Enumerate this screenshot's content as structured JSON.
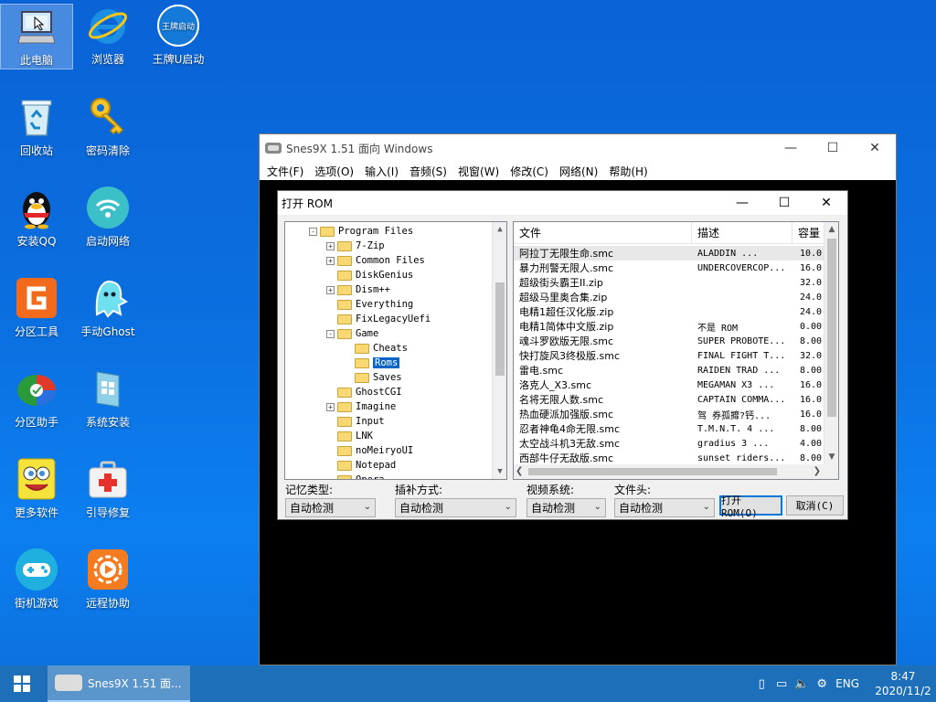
{
  "desktop": {
    "icons": [
      {
        "label": "此电脑",
        "icon": "computer-icon"
      },
      {
        "label": "浏览器",
        "icon": "ie-browser-icon"
      },
      {
        "label": "王牌U启动",
        "icon": "wangpai-icon",
        "badge": "王牌启动"
      },
      {
        "label": "回收站",
        "icon": "recycle-bin-icon"
      },
      {
        "label": "密码清除",
        "icon": "key-icon"
      },
      {
        "label": "安装QQ",
        "icon": "qq-penguin-icon"
      },
      {
        "label": "启动网络",
        "icon": "wifi-icon"
      },
      {
        "label": "分区工具",
        "icon": "diskgenius-icon"
      },
      {
        "label": "手动Ghost",
        "icon": "ghost-icon"
      },
      {
        "label": "分区助手",
        "icon": "partition-assistant-icon"
      },
      {
        "label": "系统安装",
        "icon": "system-install-icon"
      },
      {
        "label": "更多软件",
        "icon": "spongebob-icon"
      },
      {
        "label": "引导修复",
        "icon": "first-aid-kit-icon"
      },
      {
        "label": "街机游戏",
        "icon": "gamepad-icon"
      },
      {
        "label": "远程协助",
        "icon": "remote-assist-icon"
      }
    ]
  },
  "snes_window": {
    "title": "Snes9X 1.51 面向 Windows",
    "menu": [
      "文件(F)",
      "选项(O)",
      "输入(I)",
      "音频(S)",
      "视窗(W)",
      "修改(C)",
      "网络(N)",
      "帮助(H)"
    ]
  },
  "dialog": {
    "title": "打开 ROM",
    "tree": [
      {
        "label": "Program Files",
        "toggle": "-",
        "depth": 0
      },
      {
        "label": "7-Zip",
        "toggle": "+",
        "depth": 1
      },
      {
        "label": "Common Files",
        "toggle": "+",
        "depth": 1
      },
      {
        "label": "DiskGenius",
        "toggle": "",
        "depth": 1
      },
      {
        "label": "Dism++",
        "toggle": "+",
        "depth": 1
      },
      {
        "label": "Everything",
        "toggle": "",
        "depth": 1
      },
      {
        "label": "FixLegacyUefi",
        "toggle": "",
        "depth": 1
      },
      {
        "label": "Game",
        "toggle": "-",
        "depth": 1
      },
      {
        "label": "Cheats",
        "toggle": "",
        "depth": 2
      },
      {
        "label": "Roms",
        "toggle": "",
        "depth": 2,
        "selected": true
      },
      {
        "label": "Saves",
        "toggle": "",
        "depth": 2
      },
      {
        "label": "GhostCGI",
        "toggle": "",
        "depth": 1
      },
      {
        "label": "Imagine",
        "toggle": "+",
        "depth": 1
      },
      {
        "label": "Input",
        "toggle": "",
        "depth": 1
      },
      {
        "label": "LNK",
        "toggle": "",
        "depth": 1
      },
      {
        "label": "noMeiryoUI",
        "toggle": "",
        "depth": 1
      },
      {
        "label": "Notepad",
        "toggle": "",
        "depth": 1
      },
      {
        "label": "Opera",
        "toggle": "",
        "depth": 1
      }
    ],
    "columns": [
      "文件",
      "描述",
      "容量"
    ],
    "files": [
      {
        "name": "阿拉丁无限生命.smc",
        "desc": "ALADDIN     ...",
        "size": "10.0"
      },
      {
        "name": "暴力刑警无限人.smc",
        "desc": "UNDERCOVERCOP...",
        "size": "16.0"
      },
      {
        "name": "超级街头霸王II.zip",
        "desc": "",
        "size": "32.0"
      },
      {
        "name": "超级马里奥合集.zip",
        "desc": "",
        "size": "24.0"
      },
      {
        "name": "电精1超任汉化版.zip",
        "desc": "",
        "size": "24.0"
      },
      {
        "name": "电精1简体中文版.zip",
        "desc": "不是 ROM",
        "size": "0.00"
      },
      {
        "name": "魂斗罗欧版无限.smc",
        "desc": "SUPER PROBOTE...",
        "size": "8.00"
      },
      {
        "name": "快打旋风3终极版.smc",
        "desc": "FINAL FIGHT T...",
        "size": "32.0"
      },
      {
        "name": "雷电.smc",
        "desc": "RAIDEN TRAD  ...",
        "size": "8.00"
      },
      {
        "name": "洛克人_X3.smc",
        "desc": "MEGAMAN X3   ...",
        "size": "16.0"
      },
      {
        "name": "名将无限人数.smc",
        "desc": "CAPTAIN COMMA...",
        "size": "16.0"
      },
      {
        "name": "热血硬派加强版.smc",
        "desc": "驾 券孤攠?钙...",
        "size": "16.0"
      },
      {
        "name": "忍者神龟4命无限.smc",
        "desc": "T.M.N.T. 4   ...",
        "size": "8.00"
      },
      {
        "name": "太空战斗机3无敌.smc",
        "desc": "gradius 3    ...",
        "size": "4.00"
      },
      {
        "name": "西部牛仔无敌版.smc",
        "desc": "sunset riders...",
        "size": "8.00"
      }
    ],
    "labels": {
      "memory": "记忆类型:",
      "patch": "插补方式:",
      "video": "视频系统:",
      "header": "文件头:"
    },
    "combos": {
      "memory": "自动检测",
      "patch": "自动检测",
      "video": "自动检测",
      "header": "自动检测"
    },
    "open_button": "打开 ROM(O)",
    "cancel_button": "取消(C)"
  },
  "taskbar": {
    "app_label": "Snes9X 1.51 面...",
    "lang": "ENG",
    "time": "8:47",
    "date": "2020/11/2"
  },
  "colors": {
    "desktop": "#0b6fe0",
    "taskbar": "#1c6fb8",
    "selection": "#0a64c8"
  }
}
